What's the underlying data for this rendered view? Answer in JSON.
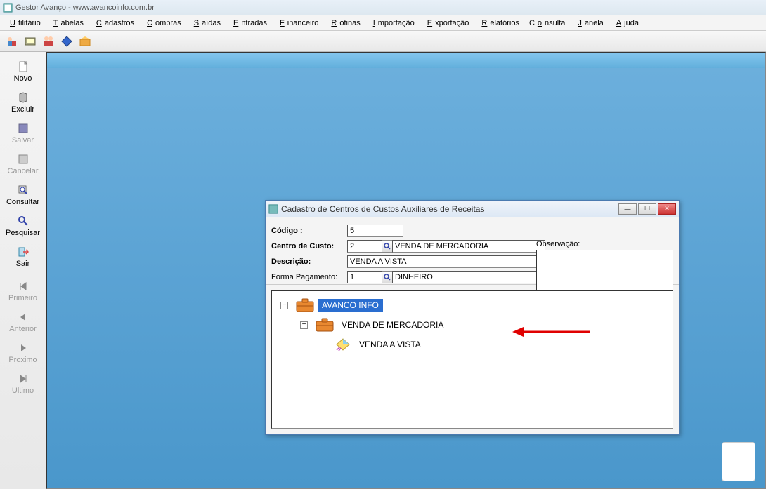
{
  "window": {
    "title": "Gestor Avanço - www.avancoinfo.com.br"
  },
  "menu": {
    "items": [
      {
        "label": "Utilitário",
        "u": 0
      },
      {
        "label": "Tabelas",
        "u": 0
      },
      {
        "label": "Cadastros",
        "u": 0
      },
      {
        "label": "Compras",
        "u": 0
      },
      {
        "label": "Saídas",
        "u": 0
      },
      {
        "label": "Entradas",
        "u": 0
      },
      {
        "label": "Financeiro",
        "u": 0
      },
      {
        "label": "Rotinas",
        "u": 0
      },
      {
        "label": "Importação",
        "u": 0
      },
      {
        "label": "Exportação",
        "u": 0
      },
      {
        "label": "Relatórios",
        "u": 0
      },
      {
        "label": "Consulta",
        "u": 1
      },
      {
        "label": "Janela",
        "u": 0
      },
      {
        "label": "Ajuda",
        "u": 0
      }
    ]
  },
  "sidebar": {
    "items": [
      {
        "label": "Novo",
        "icon": "file",
        "disabled": false
      },
      {
        "label": "Excluir",
        "icon": "delete",
        "disabled": false
      },
      {
        "label": "Salvar",
        "icon": "save",
        "disabled": true
      },
      {
        "label": "Cancelar",
        "icon": "cancel",
        "disabled": true
      },
      {
        "label": "Consultar",
        "icon": "zoom",
        "disabled": false
      },
      {
        "label": "Pesquisar",
        "icon": "search",
        "disabled": false
      },
      {
        "label": "Sair",
        "icon": "exit",
        "disabled": false
      },
      {
        "label": "Primeiro",
        "icon": "first",
        "disabled": true
      },
      {
        "label": "Anterior",
        "icon": "prev",
        "disabled": true
      },
      {
        "label": "Proximo",
        "icon": "next",
        "disabled": true
      },
      {
        "label": "Ultimo",
        "icon": "last",
        "disabled": true
      }
    ]
  },
  "child": {
    "title": "Cadastro de Centros de Custos Auxiliares de Receitas",
    "labels": {
      "codigo": "Código :",
      "centro": "Centro de Custo:",
      "descricao": "Descrição:",
      "forma": "Forma Pagamento:",
      "obs": "Observação:"
    },
    "values": {
      "codigo": "5",
      "centro_num": "2",
      "centro_desc": "VENDA DE MERCADORIA",
      "descricao": "VENDA A VISTA",
      "forma_num": "1",
      "forma_desc": "DINHEIRO",
      "obs": ""
    },
    "tree": {
      "root": "AVANCO INFO",
      "child1": "VENDA DE MERCADORIA",
      "leaf": "VENDA A VISTA"
    }
  }
}
